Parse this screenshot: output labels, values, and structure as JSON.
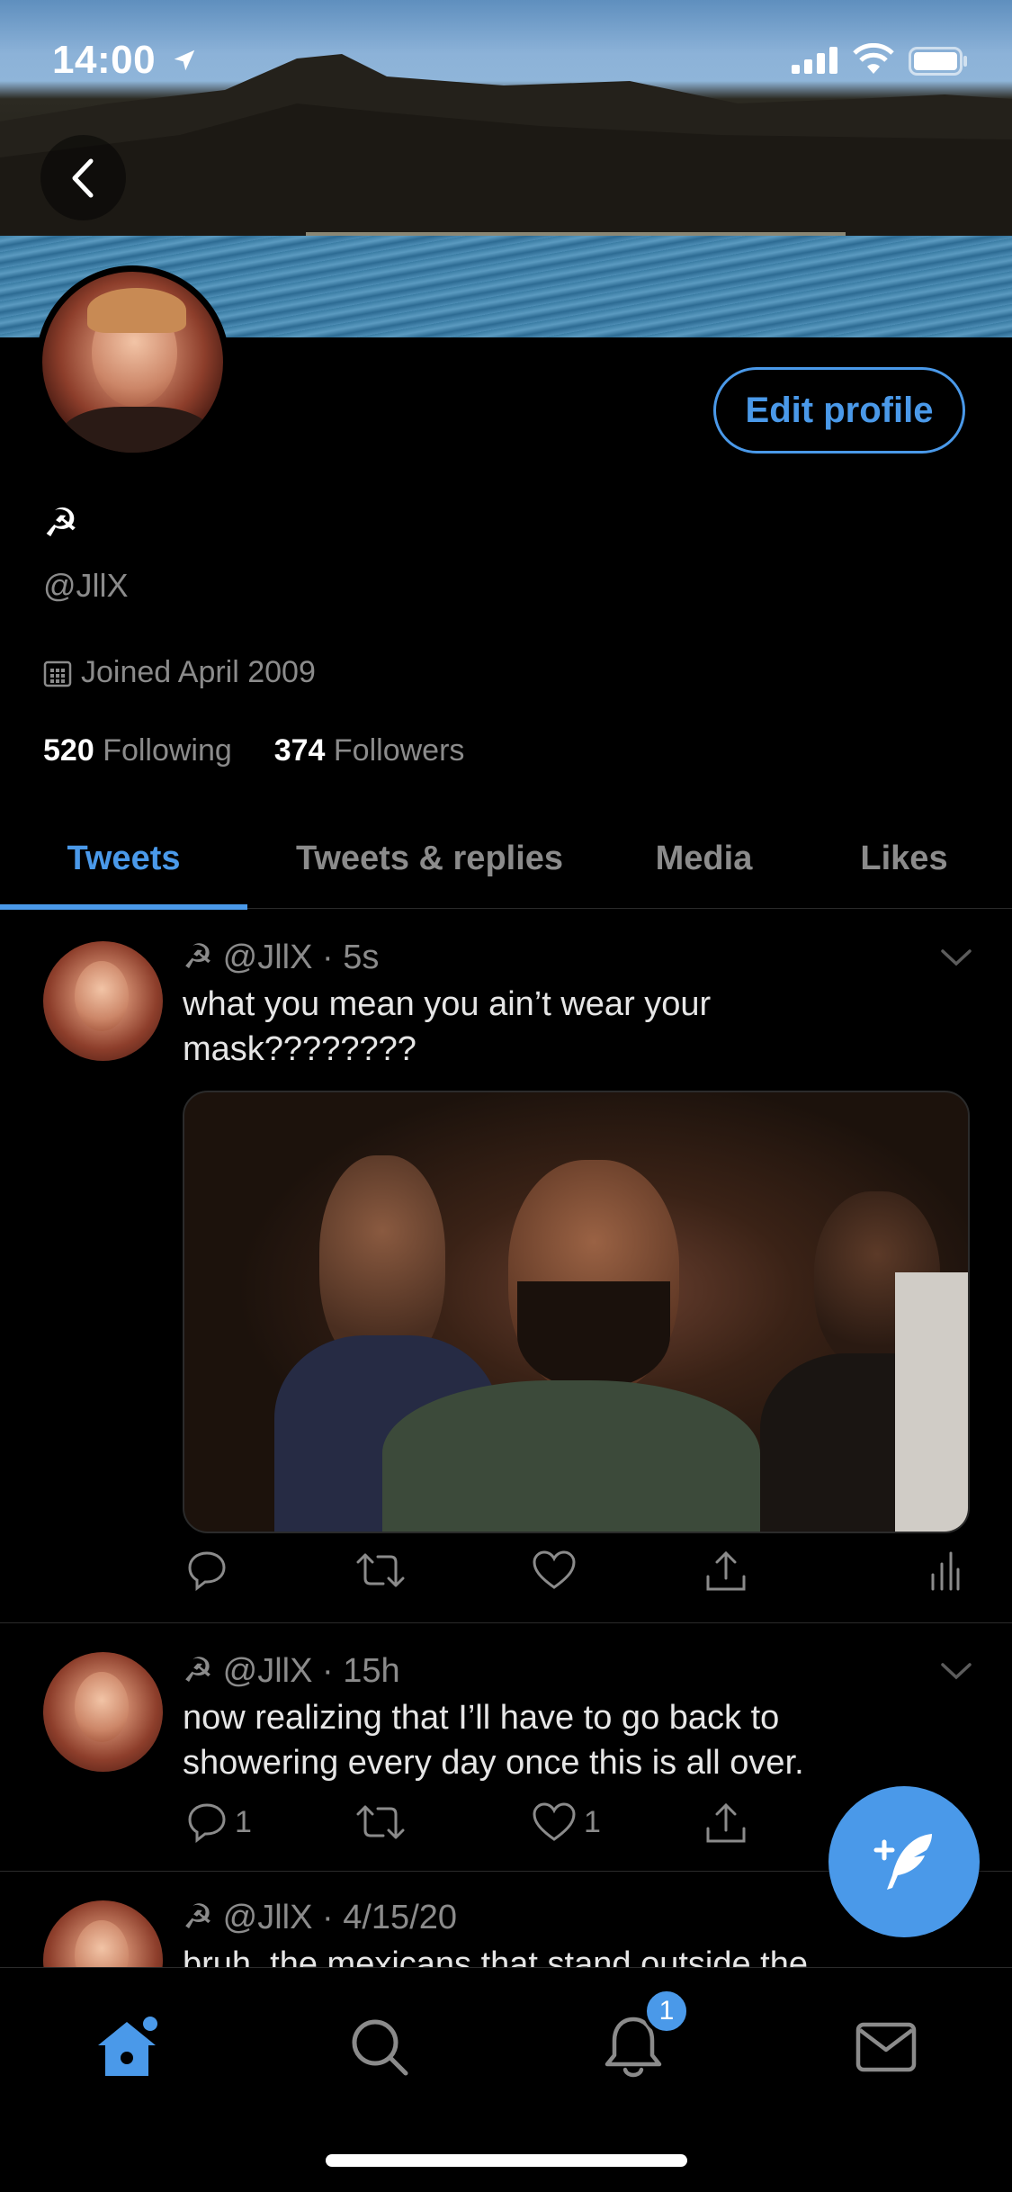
{
  "status_bar": {
    "time": "14:00"
  },
  "profile": {
    "edit_button": "Edit profile",
    "display_name": "☭",
    "handle": "@JllX",
    "joined": "Joined April 2009",
    "following_count": "520",
    "following_label": "Following",
    "followers_count": "374",
    "followers_label": "Followers"
  },
  "tabs": [
    {
      "label": "Tweets",
      "active": true
    },
    {
      "label": "Tweets & replies",
      "active": false
    },
    {
      "label": "Media",
      "active": false
    },
    {
      "label": "Likes",
      "active": false
    }
  ],
  "tweets": [
    {
      "name": "☭",
      "handle": "@JllX",
      "time": "5s",
      "text": "what you mean you ain’t wear your mask????????",
      "replies": "",
      "likes": ""
    },
    {
      "name": "☭",
      "handle": "@JllX",
      "time": "15h",
      "text": "now realizing that I’ll have to go back to showering every day once this is all over.",
      "replies": "1",
      "likes": "1"
    },
    {
      "name": "☭",
      "handle": "@JllX",
      "time": "4/15/20",
      "text": "bruh, the mexicans that stand outside the",
      "replies": "",
      "likes": ""
    }
  ],
  "notifications_badge": "1",
  "colors": {
    "accent": "#4a99e9",
    "background": "#000000",
    "muted": "#8b8b8b"
  },
  "icons": [
    "location-arrow-icon",
    "signal-icon",
    "wifi-icon",
    "battery-icon",
    "back-arrow-icon",
    "calendar-icon",
    "reply-icon",
    "retweet-icon",
    "like-icon",
    "share-icon",
    "analytics-icon",
    "chevron-down-icon",
    "compose-icon",
    "home-icon",
    "search-icon",
    "bell-icon",
    "mail-icon"
  ]
}
